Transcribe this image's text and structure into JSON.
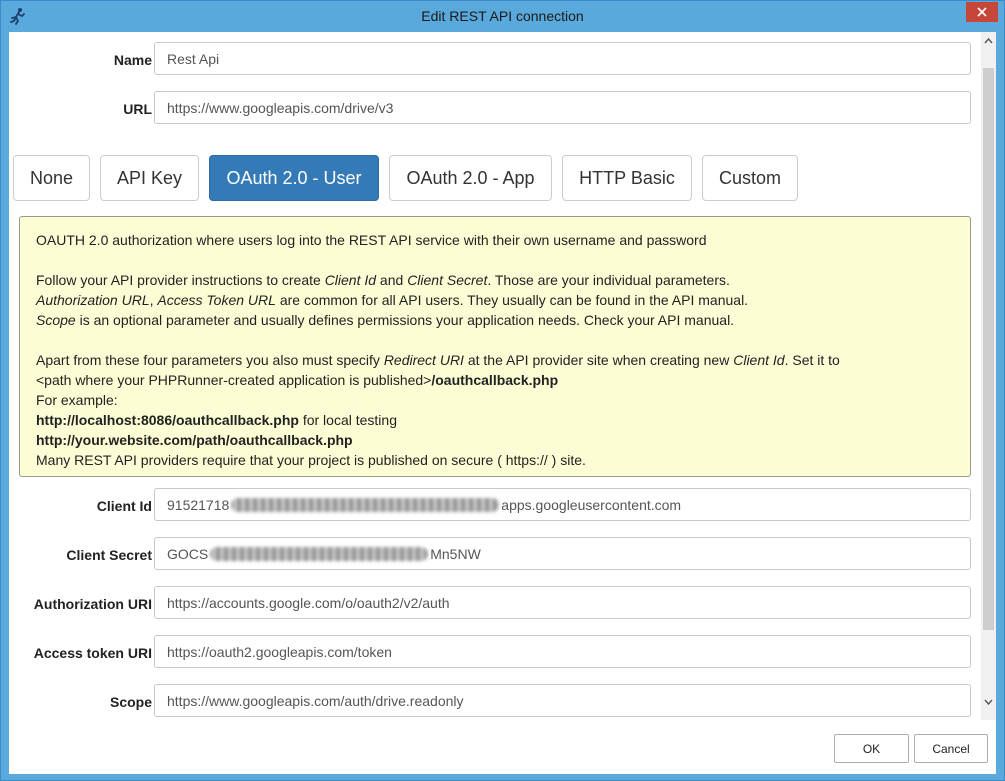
{
  "window": {
    "title": "Edit REST API connection"
  },
  "form": {
    "name": {
      "label": "Name",
      "value": "Rest Api"
    },
    "url": {
      "label": "URL",
      "value": "https://www.googleapis.com/drive/v3"
    }
  },
  "auth_tabs": [
    {
      "label": "None",
      "active": false
    },
    {
      "label": "API Key",
      "active": false
    },
    {
      "label": "OAuth 2.0 - User",
      "active": true
    },
    {
      "label": "OAuth 2.0 - App",
      "active": false
    },
    {
      "label": "HTTP Basic",
      "active": false
    },
    {
      "label": "Custom",
      "active": false
    }
  ],
  "info": {
    "line1": "OAUTH 2.0 authorization where users log into the REST API service with their own username and password",
    "l2_a": "Follow your API provider instructions to create ",
    "l2_b": "Client Id",
    "l2_c": " and ",
    "l2_d": "Client Secret",
    "l2_e": ". Those are your individual parameters.",
    "l3_a": "Authorization URL",
    "l3_b": ", ",
    "l3_c": "Access Token URL",
    "l3_d": " are common for all API users. They usually can be found in the API manual.",
    "l4_a": "Scope",
    "l4_b": " is an optional parameter and usually defines permissions your application needs. Check your API manual.",
    "l5_a": "Apart from these four parameters you also must specify ",
    "l5_b": "Redirect URI",
    "l5_c": " at the API provider site when creating new ",
    "l5_d": "Client Id",
    "l5_e": ". Set it to",
    "l6_a": "<path where your PHPRunner-created application is published>",
    "l6_b": "/oauthcallback.php",
    "l7": "For example:",
    "l8_a": "http://localhost:8086/oauthcallback.php",
    "l8_b": " for local testing",
    "l9": "http://your.website.com/path/oauthcallback.php",
    "l10": "Many REST API providers require that your project is published on secure ( https:// ) site."
  },
  "oauth": {
    "client_id": {
      "label": "Client Id",
      "value_prefix": "91521718",
      "value_suffix": "apps.googleusercontent.com"
    },
    "client_secret": {
      "label": "Client Secret",
      "value_prefix": "GOCS",
      "value_suffix": "Mn5NW"
    },
    "authorization_uri": {
      "label": "Authorization URI",
      "value": "https://accounts.google.com/o/oauth2/v2/auth"
    },
    "access_token_uri": {
      "label": "Access token URI",
      "value": "https://oauth2.googleapis.com/token"
    },
    "scope": {
      "label": "Scope",
      "value": "https://www.googleapis.com/auth/drive.readonly"
    }
  },
  "buttons": {
    "ok": "OK",
    "cancel": "Cancel"
  },
  "icons": {
    "app": "app-runner-icon",
    "close": "close-icon",
    "scroll_up": "chevron-up-icon",
    "scroll_down": "chevron-down-icon"
  },
  "colors": {
    "window_frame": "#5aa9dd",
    "close_button": "#c7463a",
    "active_tab": "#337ab7",
    "info_background": "#fdfdd5"
  }
}
